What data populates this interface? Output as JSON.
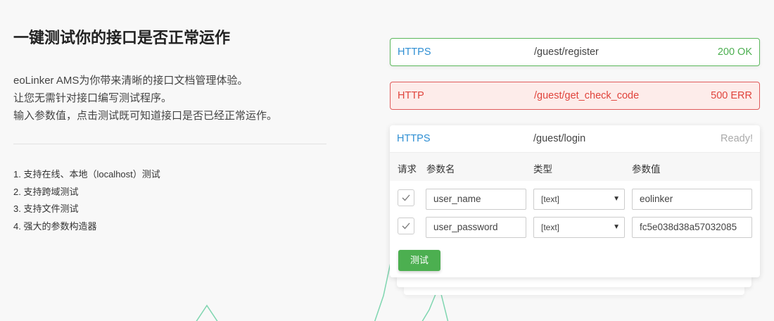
{
  "headline": "一键测试你的接口是否正常运作",
  "description": [
    "eoLinker AMS为你带来清晰的接口文档管理体验。",
    "让您无需针对接口编写测试程序。",
    "输入参数值，点击测试既可知道接口是否已经正常运作。"
  ],
  "features": [
    "1. 支持在线、本地（localhost）测试",
    "2. 支持跨域测试",
    "3. 支持文件测试",
    "4. 强大的参数构造器"
  ],
  "cards": {
    "register": {
      "protocol": "HTTPS",
      "path": "/guest/register",
      "status": "200 OK"
    },
    "check_code": {
      "protocol": "HTTP",
      "path": "/guest/get_check_code",
      "status": "500 ERR"
    }
  },
  "tester": {
    "protocol": "HTTPS",
    "path": "/guest/login",
    "status": "Ready!",
    "columns": {
      "request": "请求",
      "param_name": "参数名",
      "type": "类型",
      "value": "参数值"
    },
    "params": [
      {
        "name": "user_name",
        "type": "[text]",
        "value": "eolinker",
        "checked": true
      },
      {
        "name": "user_password",
        "type": "[text]",
        "value": "fc5e038d38a57032085",
        "checked": true
      }
    ],
    "test_label": "测试"
  },
  "colors": {
    "success": "#4caf50",
    "error": "#e0443c",
    "link": "#2f8fd3",
    "accent_line": "#7fd6b0"
  }
}
